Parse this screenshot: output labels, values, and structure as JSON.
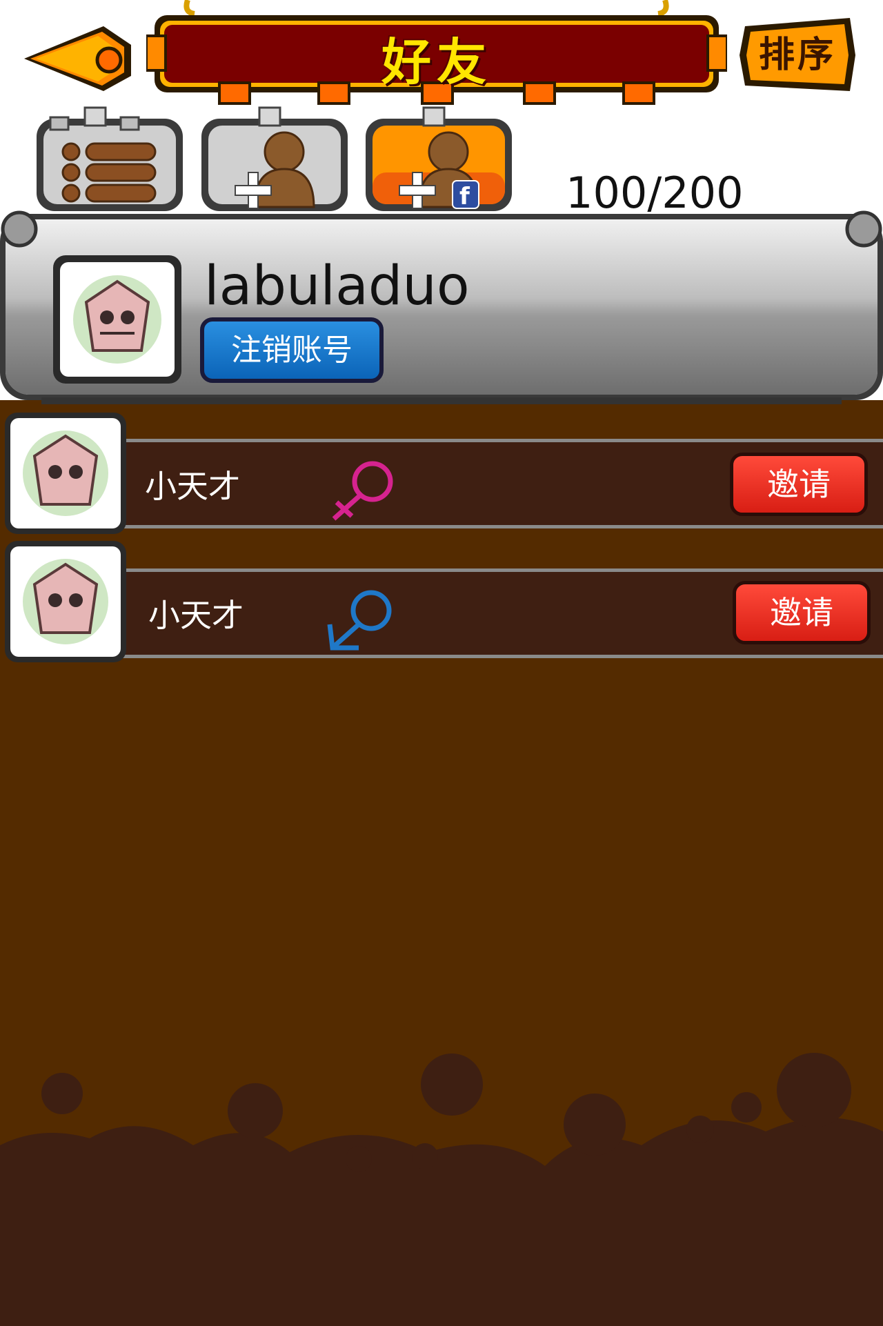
{
  "header": {
    "title": "好友",
    "sort_label": "排序"
  },
  "tabs": [
    {
      "name": "friend-list"
    },
    {
      "name": "add-friend"
    },
    {
      "name": "facebook-friends",
      "badge": "f"
    }
  ],
  "friend_count": "100/200",
  "account": {
    "username": "labuladuo",
    "logout_label": "注销账号"
  },
  "friends": [
    {
      "name": "小天才",
      "gender": "female",
      "invite_label": "邀请"
    },
    {
      "name": "小天才",
      "gender": "male",
      "invite_label": "邀请"
    }
  ],
  "colors": {
    "banner": "#7a0000",
    "banner_trim": "#ffb300",
    "list_bg": "#542b00",
    "row_bg": "#3f1f12",
    "invite": "#e52a1f",
    "logout": "#1474cf",
    "female_symbol": "#d6238f",
    "male_symbol": "#1f78c8"
  }
}
